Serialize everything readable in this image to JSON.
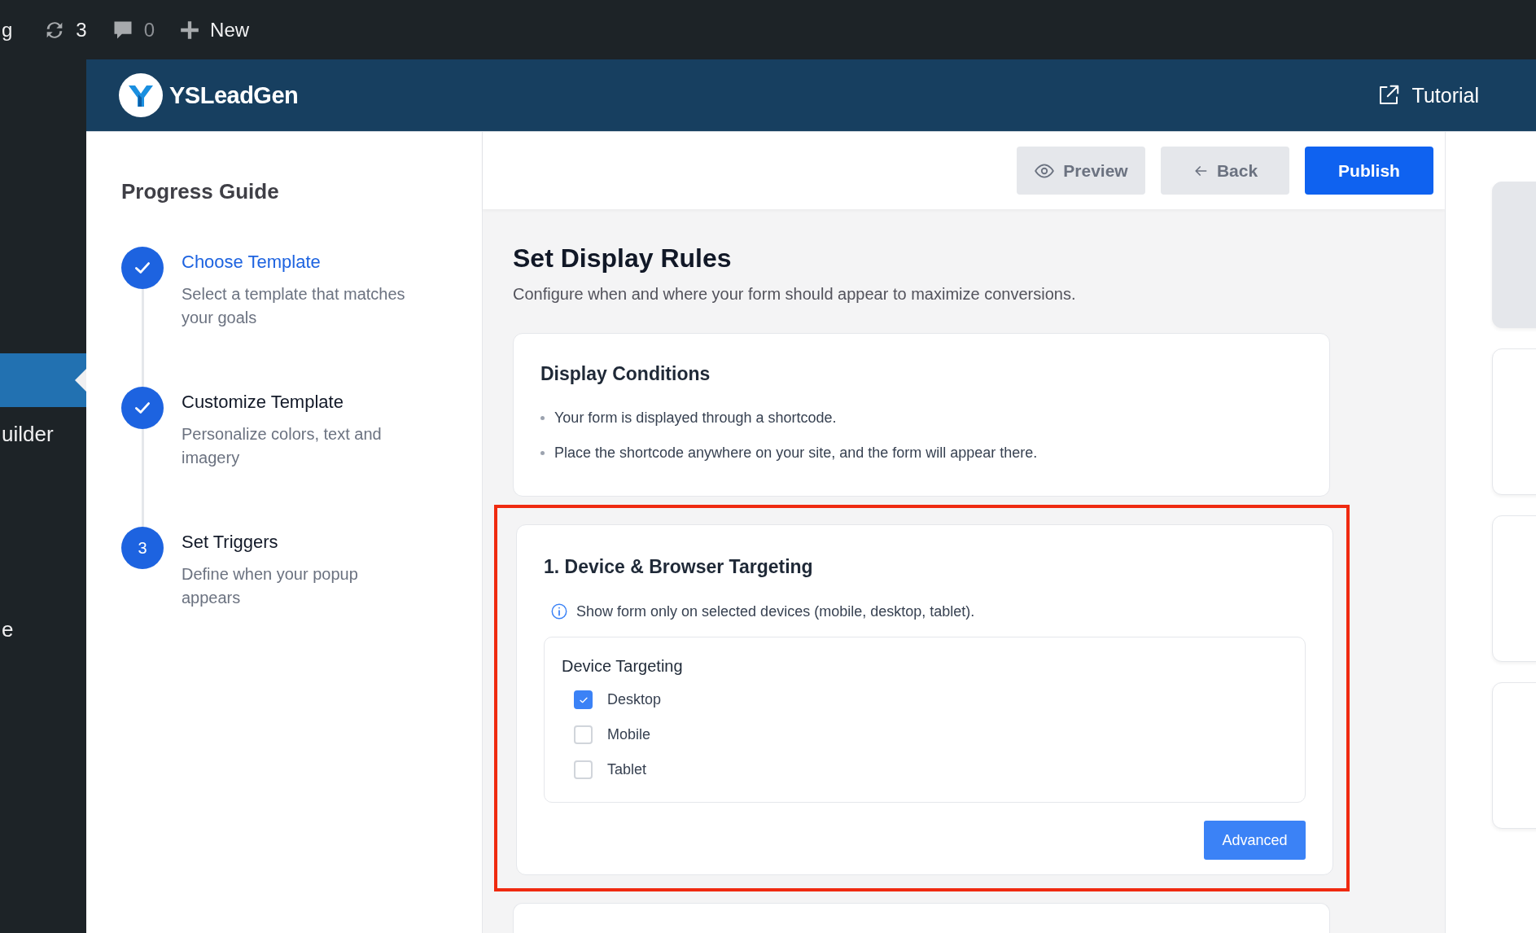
{
  "admin_bar": {
    "items": [
      {
        "kind": "text",
        "label": "g"
      },
      {
        "kind": "updates",
        "label": "3"
      },
      {
        "kind": "comments",
        "label": "0"
      },
      {
        "kind": "new",
        "label": "New"
      }
    ]
  },
  "wp_sidebar": {
    "items": [
      {
        "selected": true
      },
      {
        "label": "uilder",
        "selected": false
      },
      {
        "label": "e",
        "selected": false
      }
    ]
  },
  "header": {
    "brand": "YSLeadGen",
    "tutorial": "Tutorial"
  },
  "progress_guide": {
    "title": "Progress Guide",
    "steps": [
      {
        "title": "Choose Template",
        "description": "Select a template that matches your goals",
        "completed": true,
        "selected": true
      },
      {
        "title": "Customize Template",
        "description": "Personalize colors, text and imagery",
        "completed": true,
        "selected": false
      },
      {
        "title": "Set Triggers",
        "description": "Define when your popup appears",
        "completed": false,
        "selected": false,
        "number": "3"
      }
    ]
  },
  "toolbar": {
    "buttons": [
      {
        "kind": "preview",
        "label": "Preview"
      },
      {
        "kind": "back",
        "label": "Back"
      },
      {
        "kind": "primary",
        "label": "Publish"
      }
    ]
  },
  "page": {
    "title": "Set Display Rules",
    "subtitle": "Configure when and where your form should appear to maximize conversions."
  },
  "display_conditions": {
    "title": "Display Conditions",
    "bullets": [
      "Your form is displayed through a shortcode.",
      "Place the shortcode anywhere on your site, and the form will appear there."
    ]
  },
  "device_targeting": {
    "highlighted": true,
    "title": "1. Device & Browser Targeting",
    "info": "Show form only on selected devices (mobile, desktop, tablet).",
    "group_title": "Device Targeting",
    "options": [
      {
        "label": "Desktop",
        "checked": true
      },
      {
        "label": "Mobile",
        "checked": false
      },
      {
        "label": "Tablet",
        "checked": false
      }
    ],
    "button": "Advanced"
  }
}
